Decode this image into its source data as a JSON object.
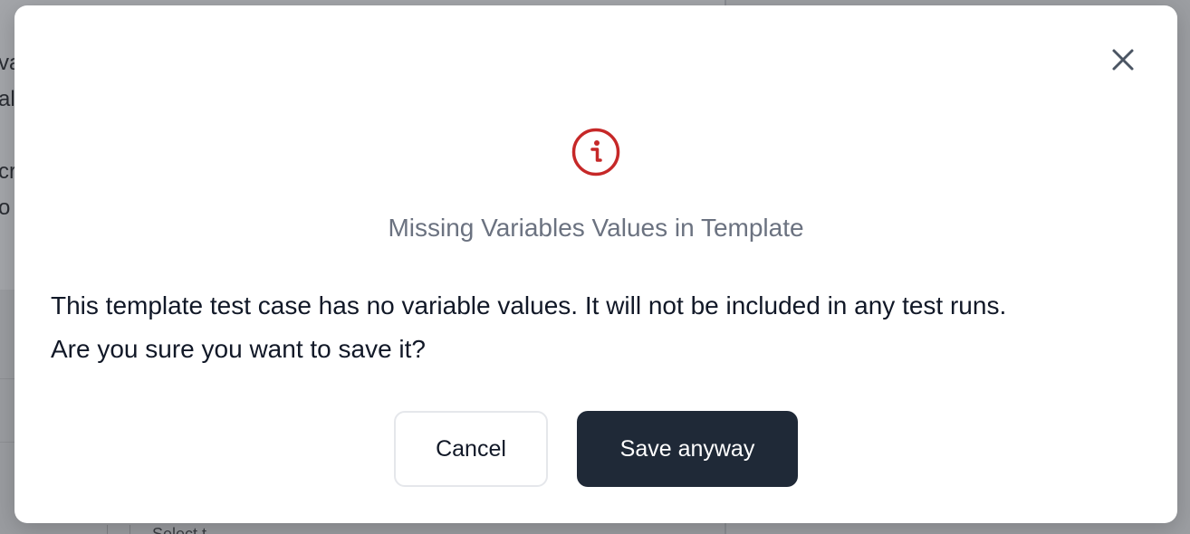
{
  "background": {
    "fragments": [
      "va",
      "al",
      "cr",
      "o"
    ],
    "bottom_text": "Select t"
  },
  "dialog": {
    "icon": "info-circle-icon",
    "icon_color": "#c62828",
    "title": "Missing Variables Values in Template",
    "message_line1": "This template test case has no variable values. It will not be included in any test runs.",
    "message_line2": "Are you sure you want to save it?",
    "cancel_label": "Cancel",
    "confirm_label": "Save anyway",
    "confirm_color": "#1f2937"
  }
}
